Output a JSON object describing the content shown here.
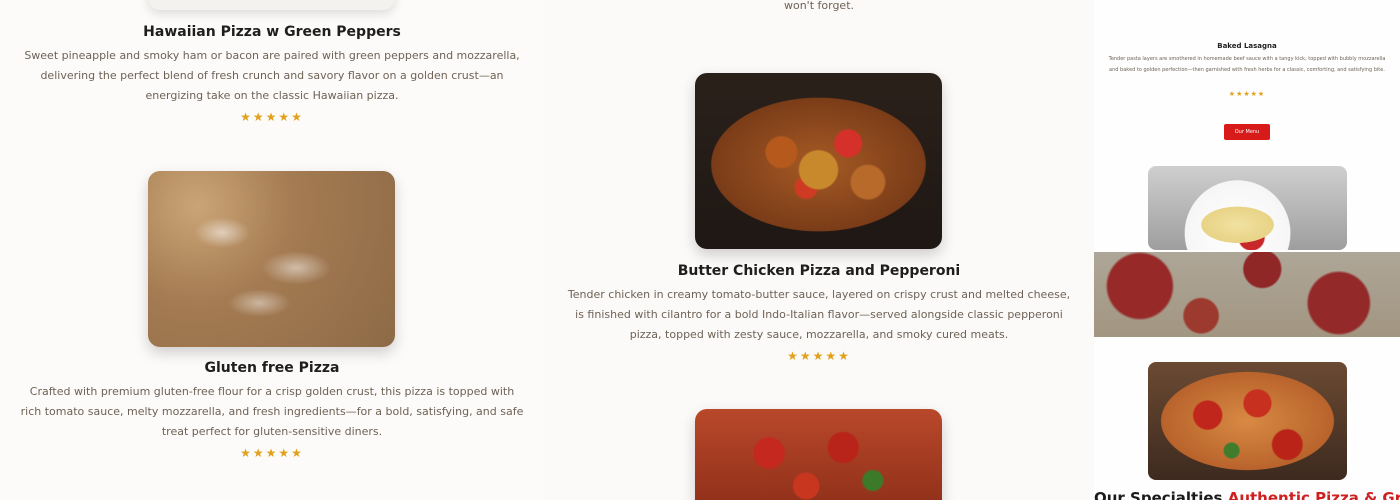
{
  "column1": {
    "item1": {
      "title": "Hawaiian Pizza w Green Peppers",
      "description": "Sweet pineapple and smoky ham or bacon are paired with green peppers and mozzarella, delivering the perfect blend of fresh crunch and savory flavor on a golden crust—an energizing take on the classic Hawaiian pizza.",
      "rating": 5
    },
    "item2": {
      "title": "Gluten free Pizza",
      "description": "Crafted with premium gluten-free flour for a crisp golden crust, this pizza is topped with rich tomato sauce, melty mozzarella, and fresh ingredients—for a bold, satisfying, and safe treat perfect for gluten-sensitive diners.",
      "rating": 5
    }
  },
  "column2": {
    "top_text": "won't forget.",
    "item1": {
      "title": "Butter Chicken Pizza and Pepperoni",
      "description": "Tender chicken in creamy tomato-butter sauce, layered on crispy crust and melted cheese, is finished with cilantro for a bold Indo-Italian flavor—served alongside classic pepperoni pizza, topped with zesty sauce, mozzarella, and smoky cured meats.",
      "rating": 5
    }
  },
  "column3": {
    "preview_title": "Baked Lasagna",
    "preview_description": "Tender pasta layers are smothered in homemade beef sauce with a tangy kick, topped with bubbly mozzarella and baked to golden perfection—then garnished with fresh herbs for a classic, comforting, and satisfying bite.",
    "rating": 5,
    "button_label": "Our Menu",
    "heading_part1": "Our Specialties",
    "heading_part2": "Authentic Pizza & Grill"
  },
  "icons": {
    "star": "star-icon"
  },
  "colors": {
    "accent": "#d01f1f",
    "star": "#e0a11b",
    "muted_text": "#6e6256"
  }
}
